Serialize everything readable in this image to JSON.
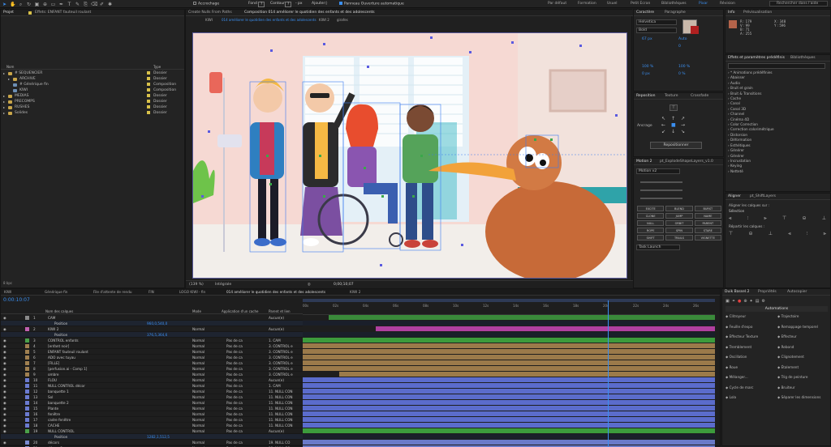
{
  "toolbar": {
    "aligner_label": "Accrochage",
    "remplir_label": "Fond",
    "contour_label": "Contour",
    "contour_value": "- px",
    "ajouter_label": "Ajouter",
    "ajouter_value": "◊",
    "panneau_label": "Panneau Ouverture automatique",
    "workspaces": [
      "Par défaut",
      "Formation",
      "Usuel",
      "Petit Ecran",
      "Bibliothèques",
      "Pixar",
      "Révision"
    ],
    "active_workspace": "Pixar",
    "search_placeholder": "Rechercher dans l'aide"
  },
  "project": {
    "tab": "Projet",
    "effects_tab": "Effets: ENFANT fauteuil roulant",
    "columns": {
      "name": "Nom",
      "type": "Type"
    },
    "items": [
      {
        "name": "# SEQUENCIER",
        "type": "Dossier",
        "kind": "folder",
        "indent": 0
      },
      {
        "name": "ARCHIVE",
        "type": "Dossier",
        "kind": "folder",
        "indent": 1
      },
      {
        "name": "# Générique fin",
        "type": "Composition",
        "kind": "comp",
        "indent": 1
      },
      {
        "name": "KIWI",
        "type": "Composition",
        "kind": "comp",
        "indent": 1
      },
      {
        "name": "MEDIAS",
        "type": "Dossier",
        "kind": "folder",
        "indent": 0
      },
      {
        "name": "PRECOMPS",
        "type": "Dossier",
        "kind": "folder",
        "indent": 0
      },
      {
        "name": "RUSHES",
        "type": "Dossier",
        "kind": "folder",
        "indent": 0
      },
      {
        "name": "Solides",
        "type": "Dossier",
        "kind": "folder",
        "indent": 0
      }
    ],
    "bpc": "8 bpc"
  },
  "composition": {
    "menu_label": "Create Nulls From Paths",
    "tab_label": "Composition 014 améliorer le quotidien des enfants et des adolescents",
    "breadcrumbs": [
      "KIWI",
      "014 améliorer le quotidien des enfants et des adolescents",
      "KIWI 2",
      "girafes"
    ],
    "zoom": "(139 %)",
    "quality": "Intégrale",
    "timecode": "0;00;10;07"
  },
  "right_top": {
    "tabs": [
      "Caractère",
      "Paragraphe"
    ],
    "font": "Helvetica",
    "style": "Bold",
    "size": "67 px",
    "leading": "Auto",
    "tracking": "0",
    "scale_v": "100 %",
    "scale_h": "100 %",
    "baseline": "0 px",
    "tsume": "0 %"
  },
  "info": {
    "tabs": [
      "Info",
      "Prévisualisation"
    ],
    "values": [
      "R : 179",
      "V : 99",
      "B : 71",
      "A : 255"
    ],
    "coords": [
      "X : 348",
      "Y : 596"
    ]
  },
  "effects_presets": {
    "tabs": [
      "Effets et paramètres prédéfinis",
      "Bibliothèques"
    ],
    "items": [
      "* Animations prédéfinies",
      "Abaisser",
      "Audio",
      "Bruit et grain",
      "Bruit & Transitions",
      "Cache",
      "Canal",
      "Canal 3D",
      "Channel",
      "Cinéma 4D",
      "Color Correction",
      "Correction colorimétrique",
      "Distorsion",
      "Déformation",
      "Esthétiques",
      "Générer",
      "Générer",
      "Incrustation",
      "Keying",
      "Netteté"
    ]
  },
  "repositionner": {
    "tabs": [
      "Reposition",
      "Texture",
      "Crossfade"
    ],
    "ancrage": "Ancrage",
    "button": "Repositionner"
  },
  "motion": {
    "tabs": [
      "Motion 2",
      "pt_ExplodeShapeLayers_v1.0"
    ],
    "version": "Motion v2",
    "task": "Task Launch",
    "buttons": [
      "EXCITE",
      "BLEND",
      "BURST",
      "CLONE",
      "JUMP",
      "NAME",
      "NULL",
      "ORBIT",
      "PARENT",
      "ROPE",
      "SPIN",
      "STARE",
      "SHIFT",
      "TRAILS",
      "VIGNETTE"
    ]
  },
  "aligner": {
    "tabs": [
      "Aligner",
      "pt_ShiftLayers"
    ],
    "aligner_les_calques": "Aligner les calques sur :",
    "selection": "Sélection",
    "repartir": "Répartir les calques :"
  },
  "timeline": {
    "tabs": [
      "KIWI",
      "Générique fin",
      "File d'attente de rendu",
      "FIN",
      "LOGO KIWI - fin",
      "014 améliorer le quotidien des enfants et des adolescents",
      "KIWI 2"
    ],
    "active_tab": 5,
    "timecode": "0:00:10:07",
    "col_name": "Nom des calques",
    "col_mode": "Mode",
    "col_track": "Application d'un cache",
    "col_parent": "Parent et lien",
    "ruler": [
      "00s",
      "02s",
      "04s",
      "06s",
      "08s",
      "10s",
      "12s",
      "14s",
      "16s",
      "18s",
      "20s",
      "22s",
      "24s",
      "26s"
    ],
    "layers": [
      {
        "num": "1",
        "name": "CAM",
        "mode": "",
        "track": "",
        "parent": "Aucun(e)",
        "color": "#8a8a8a",
        "bar": "#3a8a3a",
        "sub": false
      },
      {
        "num": "",
        "name": "Position",
        "mode": "",
        "track": "",
        "parent": "960,0,540,0",
        "color": "",
        "bar": "",
        "sub": true
      },
      {
        "num": "2",
        "name": "KIWI 2",
        "mode": "Normal",
        "track": "",
        "parent": "Aucun(e)",
        "color": "#c060b0",
        "bar": "#b040a0",
        "sub": false
      },
      {
        "num": "",
        "name": "Position",
        "mode": "",
        "track": "",
        "parent": "376,5,364,6",
        "color": "",
        "bar": "",
        "sub": true
      },
      {
        "num": "3",
        "name": "CONTROL enfants",
        "mode": "Normal",
        "track": "Pas de ca",
        "parent": "1. CAM",
        "color": "#4aa04a",
        "bar": "#3c9b3c",
        "sub": false
      },
      {
        "num": "4",
        "name": "[enfant noir]",
        "mode": "Normal",
        "track": "Pas de ca",
        "parent": "3. CONTROL e",
        "color": "#a08050",
        "bar": "#9b7a4a",
        "sub": false
      },
      {
        "num": "5",
        "name": "ENFANT fauteuil roulant",
        "mode": "Normal",
        "track": "Pas de ca",
        "parent": "3. CONTROL e",
        "color": "#a08050",
        "bar": "#9b7a4a",
        "sub": false
      },
      {
        "num": "6",
        "name": "ADO avec tuyau",
        "mode": "Normal",
        "track": "Pas de ca",
        "parent": "3. CONTROL e",
        "color": "#a08050",
        "bar": "#9b7a4a",
        "sub": false
      },
      {
        "num": "7",
        "name": "[FILLE]",
        "mode": "Normal",
        "track": "Pas de ca",
        "parent": "3. CONTROL e",
        "color": "#a08050",
        "bar": "#9b7a4a",
        "sub": false
      },
      {
        "num": "8",
        "name": "[perfusion.ai - Comp 1]",
        "mode": "Normal",
        "track": "Pas de ca",
        "parent": "3. CONTROL e",
        "color": "#a08050",
        "bar": "#9b7a4a",
        "sub": false
      },
      {
        "num": "9",
        "name": "ombre",
        "mode": "Normal",
        "track": "Pas de ca",
        "parent": "3. CONTROL e",
        "color": "#a08050",
        "bar": "#9b7a4a",
        "sub": false
      },
      {
        "num": "10",
        "name": "FLOU",
        "mode": "Normal",
        "track": "Pas de ca",
        "parent": "Aucun(e)",
        "color": "#6a7ad0",
        "bar": "#5b6ccc",
        "sub": false
      },
      {
        "num": "11",
        "name": "NULL CONTROL décor",
        "mode": "Normal",
        "track": "Pas de ca",
        "parent": "1. CAM",
        "color": "#6a7ad0",
        "bar": "#5b6ccc",
        "sub": false
      },
      {
        "num": "12",
        "name": "banquette 1",
        "mode": "Normal",
        "track": "Pas de ca",
        "parent": "11. NULL CON",
        "color": "#6a7ad0",
        "bar": "#5b6ccc",
        "sub": false
      },
      {
        "num": "13",
        "name": "Sol",
        "mode": "Normal",
        "track": "Pas de ca",
        "parent": "11. NULL CON",
        "color": "#6a7ad0",
        "bar": "#5b6ccc",
        "sub": false
      },
      {
        "num": "14",
        "name": "banquette 2",
        "mode": "Normal",
        "track": "Pas de ca",
        "parent": "11. NULL CON",
        "color": "#6a7ad0",
        "bar": "#5b6ccc",
        "sub": false
      },
      {
        "num": "15",
        "name": "Plante",
        "mode": "Normal",
        "track": "Pas de ca",
        "parent": "11. NULL CON",
        "color": "#6a7ad0",
        "bar": "#5b6ccc",
        "sub": false
      },
      {
        "num": "16",
        "name": "fenêtre",
        "mode": "Normal",
        "track": "Pas de ca",
        "parent": "11. NULL CON",
        "color": "#6a7ad0",
        "bar": "#5b6ccc",
        "sub": false
      },
      {
        "num": "17",
        "name": "cadre fenêtre",
        "mode": "Normal",
        "track": "Pas de ca",
        "parent": "11. NULL CON",
        "color": "#6a7ad0",
        "bar": "#5b6ccc",
        "sub": false
      },
      {
        "num": "18",
        "name": "CACHE",
        "mode": "Normal",
        "track": "Pas de ca",
        "parent": "11. NULL CON",
        "color": "#6a7ad0",
        "bar": "#5b6ccc",
        "sub": false
      },
      {
        "num": "19",
        "name": "NULL CONTROL",
        "mode": "Normal",
        "track": "Pas de ca",
        "parent": "Aucun(e)",
        "color": "#4aa04a",
        "bar": "#3c9b3c",
        "sub": false
      },
      {
        "num": "",
        "name": "Position",
        "mode": "",
        "track": "",
        "parent": "1282,1,512,5",
        "color": "",
        "bar": "",
        "sub": true
      },
      {
        "num": "20",
        "name": "décors",
        "mode": "Normal",
        "track": "Pas de ca",
        "parent": "19. NULL CO",
        "color": "#7a8ad0",
        "bar": "#6a7ac8",
        "sub": false
      },
      {
        "num": "21",
        "name": "décors 2",
        "mode": "Normal",
        "track": "Pas de ca",
        "parent": "19. NULL CO",
        "color": "#7a8ad0",
        "bar": "#6a7ac8",
        "sub": false
      }
    ]
  },
  "duik": {
    "tabs": [
      "Duik Bassel.2",
      "Propriétés",
      "Autocopier"
    ],
    "header": "Automations",
    "items_left": [
      "Clitroyeur",
      "Feuille d'expo",
      "Effecteur Texture",
      "Tremblement",
      "Oscillation",
      "Roue",
      "Mélanger...",
      "Cycle de marc",
      "Lola"
    ],
    "items_right": [
      "Trajectoire",
      "Remappage temporel",
      "Effecteur",
      "Rebond",
      "Clignotement",
      "Étalement",
      "Trig de peinture",
      "Bruiteur",
      "Séparer les dimensions"
    ]
  },
  "colors": {
    "accent": "#3b8ff0",
    "playhead": "#3b8ff0",
    "wall": "#f6d9d3",
    "floor": "#f2eeea"
  }
}
